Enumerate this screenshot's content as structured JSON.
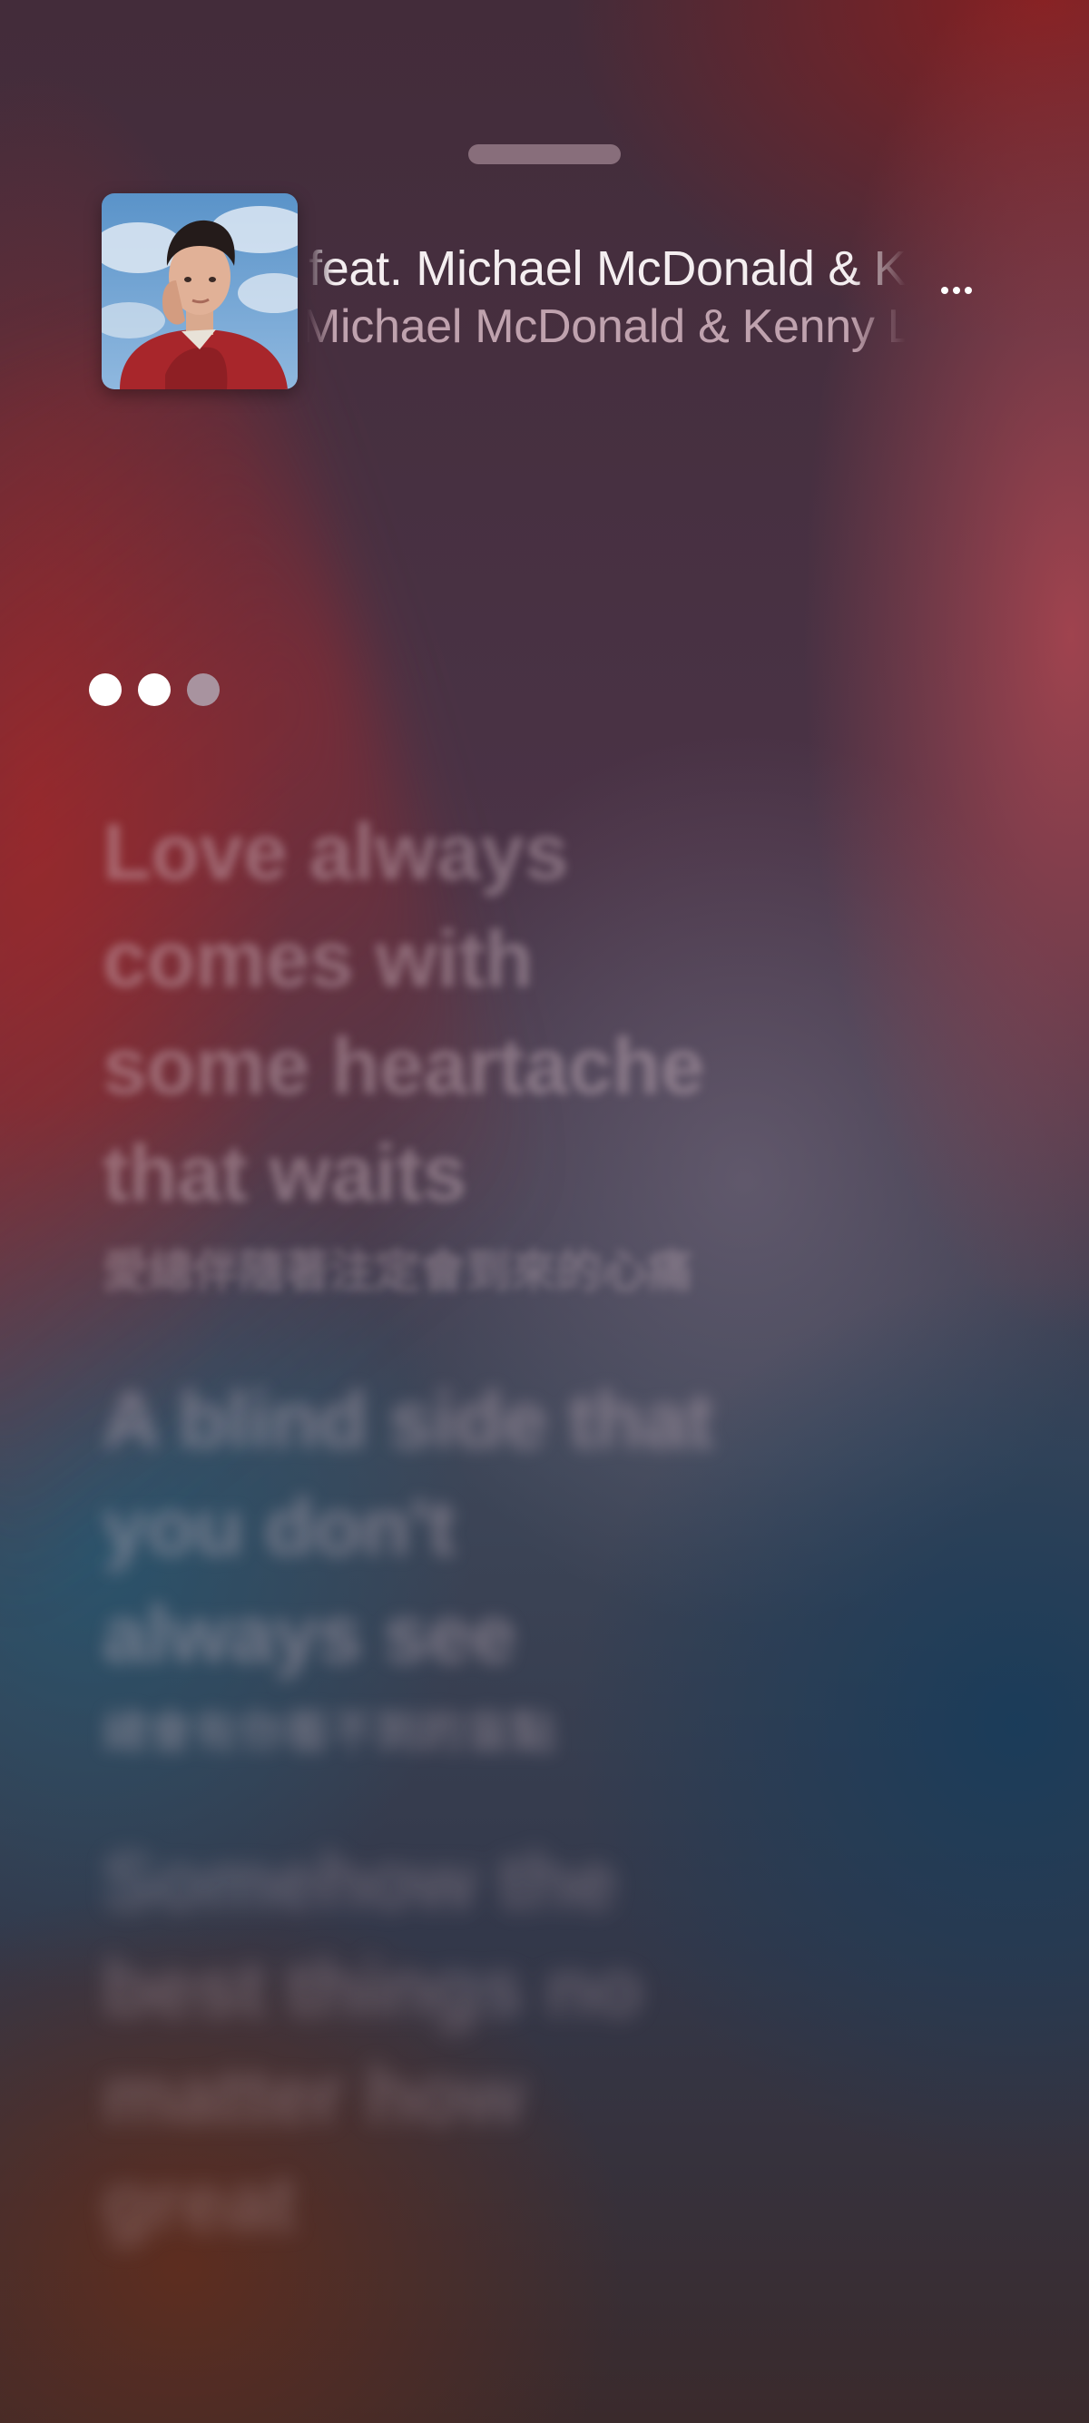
{
  "now_playing": {
    "title": "feat. Michael McDonald & Kenny Loggins",
    "artist": "Michael McDonald & Kenny Loggins"
  },
  "icons": {
    "grabber": "drag-handle",
    "more": "more-ellipsis-icon",
    "interlude": "interlude-dots-indicator"
  },
  "interlude_progress": {
    "dots_total": 3,
    "dots_lit": 2
  },
  "lyrics": [
    {
      "lines": [
        "Love always",
        "comes with",
        "some heartache",
        "that waits"
      ],
      "translation": "愛總伴隨著注定會到來的心痛"
    },
    {
      "lines": [
        "A blind side that",
        "you don't",
        "always see"
      ],
      "translation": "總會有你看不到的盲點"
    },
    {
      "lines": [
        "Somehow the",
        "best things no",
        "matter how",
        "great"
      ],
      "translation": ""
    }
  ],
  "colors": {
    "text_primary": "#f4eef0",
    "text_secondary": "#e1c3cd",
    "dot_active": "#ffffff",
    "dot_inactive": "#a8939f"
  }
}
